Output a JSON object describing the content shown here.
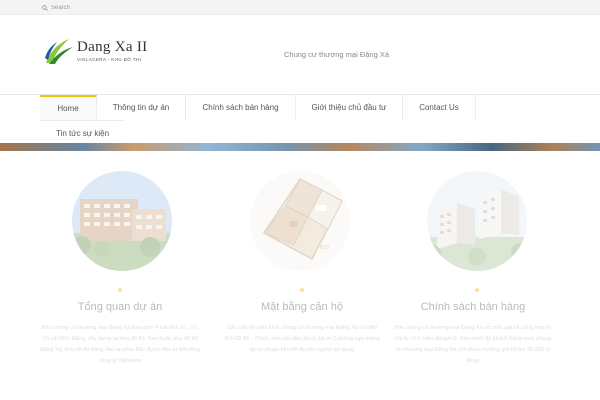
{
  "search": {
    "placeholder": "Search",
    "icon": "search-icon"
  },
  "brand": {
    "name": "Dang Xa II",
    "subtitle": "VIGLACERA - KHU ĐÔ THỊ",
    "colors": [
      "#2e8b2e",
      "#8cc63f",
      "#1a5f9c"
    ]
  },
  "header": {
    "tagline": "Chung cư thương mại Đặng Xá"
  },
  "nav": {
    "accent_color": "#f1c40f",
    "items": [
      {
        "label": "Home",
        "active": true
      },
      {
        "label": "Thông tin dự án",
        "active": false
      },
      {
        "label": "Chính sách bán hàng",
        "active": false
      },
      {
        "label": "Giới thiệu chủ đầu tư",
        "active": false
      },
      {
        "label": "Contact Us",
        "active": false
      },
      {
        "label": "Tin tức sự kiện",
        "active": false
      }
    ]
  },
  "features": [
    {
      "title": "Tổng quan dự án",
      "desc": "Khu chung cư thương mại Đặng Xá bao gồm 4 toà nhà V1, V2, V3 và OH1-Đặng, xây dựng tại khu đô thị, Nơi thuộc khu đô thị Đặng Xá, khu đô thị hàng đầu tại phía Bắc được đầu tư bởi tổng công ty Viglacera"
    },
    {
      "title": "Mặt bằng căn hộ",
      "desc": "Các căn hộ nằm khối chung cư thương mại Đặng Xá có diện tích 62-65 - 70m2, mỗi căn đều được bố trí 2 phòng ngủ mang lại sự thuận tiện tối đa cho người sử dụng"
    },
    {
      "title": "Chính sách bán hàng",
      "desc": "Khu chung cư thương mại Đặng Xá có mức giá cả cùng hợp lý, chỉ từ 11,5 triệu đồng/m2. Bên cạnh đó khách hàng mua chung cư thương mại Đặng Xá còn được hưởng gói hỗ trợ 30.000 tỷ đồng."
    }
  ]
}
